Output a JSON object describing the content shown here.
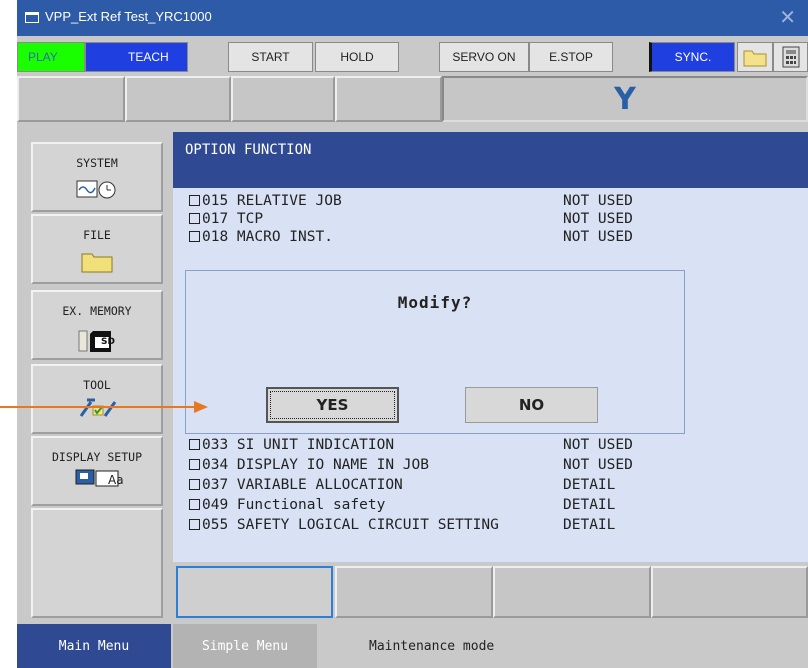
{
  "window": {
    "title": "VPP_Ext Ref Test_YRC1000",
    "close_symbol": "✕"
  },
  "toolbar": {
    "play": "PLAY",
    "teach": "TEACH",
    "start": "START",
    "hold": "HOLD",
    "servo_on": "SERVO ON",
    "estop": "E.STOP",
    "sync": "SYNC."
  },
  "indicator": {
    "coord": "Y"
  },
  "sidebar": {
    "system": "SYSTEM",
    "file": "FILE",
    "ex_memory": "EX. MEMORY",
    "sd_label": "SD",
    "tool": "TOOL",
    "display_setup": "DISPLAY SETUP",
    "aa_label": "Aa"
  },
  "content": {
    "title": "OPTION FUNCTION",
    "items": [
      {
        "code": "015 RELATIVE JOB",
        "status": "NOT USED"
      },
      {
        "code": "017 TCP",
        "status": "NOT USED"
      },
      {
        "code": "018 MACRO INST.",
        "status": "NOT USED"
      },
      {
        "code": "033 SI UNIT INDICATION",
        "status": "NOT USED"
      },
      {
        "code": "034 DISPLAY IO NAME IN JOB",
        "status": "NOT USED"
      },
      {
        "code": "037 VARIABLE ALLOCATION",
        "status": "DETAIL"
      },
      {
        "code": "049 Functional safety",
        "status": "DETAIL"
      },
      {
        "code": "055 SAFETY LOGICAL CIRCUIT SETTING",
        "status": "DETAIL"
      }
    ]
  },
  "dialog": {
    "question": "Modify?",
    "yes": "YES",
    "no": "NO"
  },
  "statusbar": {
    "main_menu": "Main Menu",
    "simple_menu": "Simple Menu",
    "mode": "Maintenance mode"
  },
  "colors": {
    "play": "#1aff00",
    "teach": "#1f3fe0",
    "header": "#2f4a93",
    "arrow": "#e87722",
    "titlebar": "#2e5ba8"
  }
}
